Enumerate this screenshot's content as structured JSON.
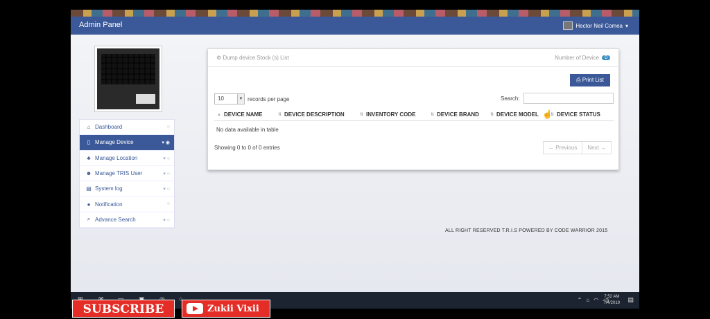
{
  "navbar": {
    "brand": "Admin Panel",
    "user": "Hector Neil Comea"
  },
  "sidebar": {
    "items": [
      {
        "label": "Dashboard",
        "icon": "home-icon",
        "glyph": "⌂",
        "tail": "○"
      },
      {
        "label": "Manage Device",
        "icon": "tablet-icon",
        "glyph": "▯",
        "tail": "▾ ◉",
        "active": true
      },
      {
        "label": "Manage Location",
        "icon": "sitemap-icon",
        "glyph": "♣",
        "tail": "▾ ○"
      },
      {
        "label": "Manage TRIS User",
        "icon": "users-icon",
        "glyph": "☻",
        "tail": "▾ ○"
      },
      {
        "label": "System log",
        "icon": "book-icon",
        "glyph": "▤",
        "tail": "▾ ○"
      },
      {
        "label": "Notification",
        "icon": "globe-icon",
        "glyph": "●",
        "tail": "○"
      },
      {
        "label": "Advance Search",
        "icon": "search-icon",
        "glyph": "⌕",
        "tail": "▾ ○"
      }
    ]
  },
  "panel": {
    "title": "⚙ Dump device Stock (s) List",
    "count_label": "Number of Device",
    "count": "0",
    "print_label": "Print List",
    "length_value": "10",
    "length_label": "records per page",
    "search_label": "Search:",
    "columns": [
      "DEVICE NAME",
      "DEVICE DESCRIPTION",
      "INVENTORY CODE",
      "DEVICE BRAND",
      "DEVICE MODEL",
      "DEVICE STATUS"
    ],
    "empty_text": "No data available in table",
    "info_text": "Showing 0 to 0 of 0 entries",
    "prev_label": "← Previous",
    "next_label": "Next →"
  },
  "footer": {
    "text": "ALL RIGHT RESERVED T.R.I.S POWERED BY CODE WARRIOR 2015"
  },
  "taskbar": {
    "time": "7:52 AM",
    "date": "7/4/2019"
  },
  "overlay": {
    "subscribe": "SUBSCRIBE",
    "channel": "Zukii Vixii"
  },
  "colors": {
    "primary": "#3b5998",
    "badge": "#3b8fc4",
    "subscribe_red": "#e52d27"
  }
}
